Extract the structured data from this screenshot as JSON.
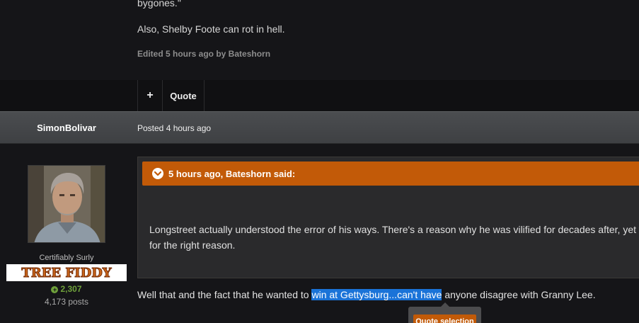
{
  "previous_post": {
    "text_line_1": "bygones.\"",
    "text_line_2": "Also, Shelby Foote can rot in hell.",
    "edited_note": "Edited 5 hours ago by Bateshorn",
    "actions": {
      "plus_label": "+",
      "quote_label": "Quote"
    }
  },
  "post": {
    "author": "SimonBolivar",
    "posted": "Posted 4 hours ago",
    "user_title": "Certifiably Surly",
    "rank_badge_text": "TREE FIDDY",
    "reputation": "2,307",
    "post_count": "4,173 posts",
    "quote": {
      "citation": "5 hours ago, Bateshorn said:",
      "line_1": "Longstreet actually understood the error of his ways. There's a reason why he was vilified for decades after, yet w",
      "line_2": "for the right reason."
    },
    "reply": {
      "before": "Well that and the fact that he wanted to ",
      "selected": "win at Gettysburg...can't have",
      "after": " anyone disagree with Granny Lee."
    },
    "quote_selection_label": "Quote selection"
  },
  "colors": {
    "accent": "#c25a08",
    "background": "#151518",
    "header_bar": "#45474a",
    "selection": "#1a73d8",
    "reputation": "#6fa13b"
  },
  "icons": {
    "quote_toggle": "chevron-down-circle-icon",
    "reputation": "plus-circle-icon"
  }
}
